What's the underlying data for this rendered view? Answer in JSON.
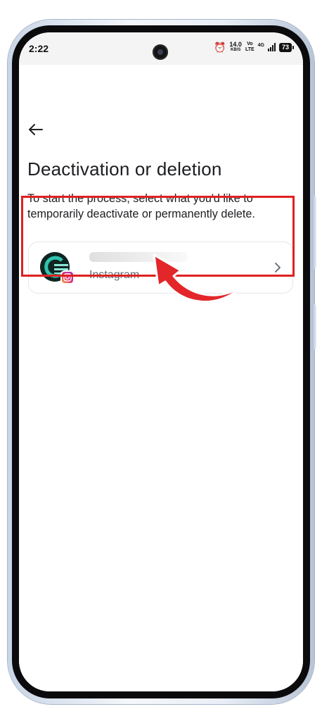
{
  "status_bar": {
    "time": "2:22",
    "net_speed_value": "14.0",
    "net_speed_unit": "KB/S",
    "volte_top": "Vo",
    "volte_bottom": "LTE",
    "network_type": "4G",
    "battery": "73"
  },
  "page": {
    "title": "Deactivation or deletion",
    "description": "To start the process, select what you'd like to temporarily deactivate or permanently delete."
  },
  "account": {
    "platform": "Instagram"
  },
  "icons": {
    "back": "back-arrow-icon",
    "chevron": "chevron-right-icon",
    "instagram": "instagram-icon",
    "alarm": "alarm-icon"
  },
  "colors": {
    "highlight": "#df2020",
    "text_primary": "#1c1e21",
    "text_secondary": "#606770"
  }
}
